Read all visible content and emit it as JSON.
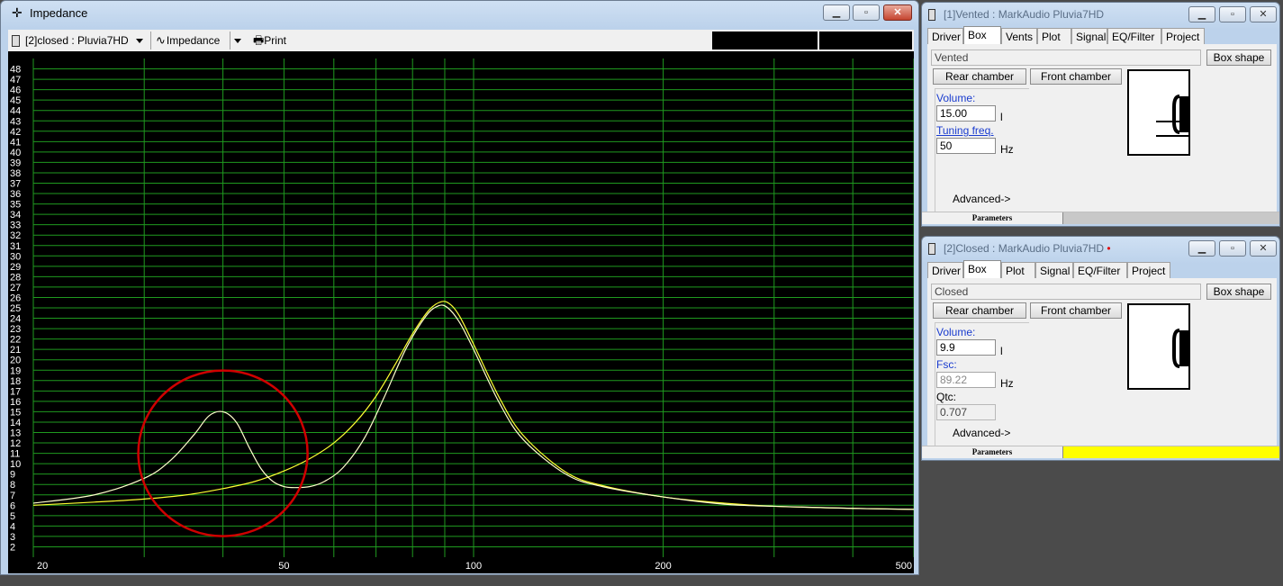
{
  "main_window": {
    "title": "Impedance",
    "toolbar": {
      "project_select": "[2]closed : Pluvia7HD",
      "plot_select": "Impedance",
      "print_label": "Print"
    },
    "y_ticks": [
      "48",
      "47",
      "46",
      "45",
      "44",
      "43",
      "42",
      "41",
      "40",
      "39",
      "38",
      "37",
      "36",
      "35",
      "34",
      "33",
      "32",
      "31",
      "30",
      "29",
      "28",
      "27",
      "26",
      "25",
      "24",
      "23",
      "22",
      "21",
      "20",
      "19",
      "18",
      "17",
      "16",
      "15",
      "14",
      "13",
      "12",
      "11",
      "10",
      "9",
      "8",
      "7",
      "6",
      "5",
      "4",
      "3",
      "2"
    ],
    "x_tick_labels": [
      "20",
      "50",
      "100",
      "200",
      "500"
    ]
  },
  "chart_data": {
    "type": "line",
    "title": "",
    "xlabel": "",
    "ylabel": "",
    "x_scale": "log",
    "xlim": [
      20,
      500
    ],
    "ylim": [
      1,
      49
    ],
    "grid": true,
    "series": [
      {
        "color": "#ffff33",
        "x": [
          20,
          25,
          30,
          35,
          40,
          45,
          50,
          55,
          60,
          65,
          70,
          75,
          80,
          85,
          89,
          92,
          95,
          100,
          110,
          120,
          140,
          160,
          200,
          250,
          300,
          400,
          500
        ],
        "y": [
          6.0,
          6.3,
          6.6,
          7.0,
          7.6,
          8.3,
          9.3,
          10.5,
          12.0,
          14.0,
          16.5,
          19.5,
          22.5,
          24.8,
          25.6,
          25.3,
          24.2,
          21.5,
          16.3,
          12.7,
          9.2,
          7.9,
          6.8,
          6.2,
          5.9,
          5.7,
          5.6
        ]
      },
      {
        "color": "#ffffcc",
        "x": [
          20,
          25,
          30,
          33,
          36,
          38,
          40,
          42,
          44,
          46,
          48,
          50,
          52,
          55,
          58,
          62,
          67,
          72,
          78,
          84,
          88,
          91,
          95,
          100,
          110,
          120,
          140,
          160,
          200,
          250,
          300,
          400,
          500
        ],
        "y": [
          6.2,
          7.0,
          8.6,
          10.3,
          12.8,
          14.6,
          15.0,
          14.0,
          11.6,
          9.5,
          8.3,
          7.8,
          7.7,
          7.8,
          8.3,
          9.6,
          12.4,
          16.3,
          21.0,
          24.2,
          25.2,
          25.0,
          23.6,
          21.0,
          15.8,
          12.3,
          9.0,
          7.8,
          6.8,
          6.1,
          5.9,
          5.7,
          5.6
        ]
      }
    ],
    "annotation": {
      "shape": "circle",
      "color": "#d00000",
      "center_x": 40,
      "center_y": 11
    }
  },
  "vented_window": {
    "title": "[1]Vented : MarkAudio Pluvia7HD",
    "tabs": [
      "Driver",
      "Box",
      "Vents",
      "Plot",
      "Signal",
      "EQ/Filter",
      "Project"
    ],
    "active_tab": "Box",
    "box_type": "Vented",
    "box_shape_label": "Box shape",
    "rear_chamber_label": "Rear chamber",
    "front_chamber_label": "Front chamber",
    "volume_label": "Volume:",
    "volume_value": "15.00",
    "volume_unit": "l",
    "tuning_label": "Tuning freq.",
    "tuning_value": "50",
    "tuning_unit": "Hz",
    "advanced_label": "Advanced->",
    "status_label": "Parameters",
    "status_color": "#c8c8c8"
  },
  "closed_window": {
    "title": "[2]Closed : MarkAudio Pluvia7HD",
    "tabs": [
      "Driver",
      "Box",
      "Plot",
      "Signal",
      "EQ/Filter",
      "Project"
    ],
    "active_tab": "Box",
    "box_type": "Closed",
    "box_shape_label": "Box shape",
    "rear_chamber_label": "Rear chamber",
    "front_chamber_label": "Front chamber",
    "volume_label": "Volume:",
    "volume_value": "9.9",
    "volume_unit": "l",
    "fsc_label": "Fsc:",
    "fsc_value": "89.22",
    "fsc_unit": "Hz",
    "qtc_label": "Qtc:",
    "qtc_value": "0.707",
    "advanced_label": "Advanced->",
    "status_label": "Parameters",
    "status_color": "#ffff00"
  }
}
